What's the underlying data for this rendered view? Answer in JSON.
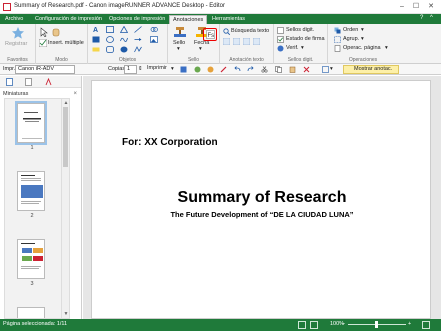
{
  "window": {
    "title": "Summary of Research.pdf - Canon imageRUNNER ADVANCE Desktop - Editor",
    "controls": [
      "–",
      "☐",
      "✕"
    ]
  },
  "menu": {
    "tabs": [
      "Archivo",
      "Configuración de impresión",
      "Opciones de impresión",
      "Anotaciones",
      "Herramientas"
    ],
    "active": "Anotaciones",
    "right_controls": [
      "?",
      "^"
    ]
  },
  "ribbon": {
    "favorites": {
      "register": "Registrar",
      "label": "Favoritos"
    },
    "mode": {
      "insert_multiple": "Insert. múltiple",
      "label": "Modo"
    },
    "objects": {
      "label": "Objetos"
    },
    "stamp": {
      "seal": "Sello",
      "date": "Fecha",
      "label": "Sello"
    },
    "annotation_text": {
      "search": "Búsqueda texto",
      "label": "Anotación texto"
    },
    "digital_seals": {
      "seals": "Sellos digit.",
      "signature_status": "Estado de firma",
      "verify": "Verif.",
      "label": "Sellos digit."
    },
    "operations": {
      "order": "Orden",
      "group": "Agrup.",
      "page_ops": "Operac. página",
      "label": "Operaciones"
    }
  },
  "toolbar": {
    "printer_label": "Impr.",
    "printer_value": "Canon iR-ADV",
    "copies_label": "Copias",
    "copies_value": "1",
    "print_label": "Imprimir",
    "show_annotations": "Mostrar anotac."
  },
  "sidebar": {
    "heading": "Miniaturas",
    "close": "×",
    "pages": [
      "1",
      "2",
      "3"
    ]
  },
  "document": {
    "for_line": "For: XX Corporation",
    "title": "Summary of Research",
    "subtitle": "The Future Development of “DE LA CIUDAD LUNA”"
  },
  "status": {
    "selected": "Página seleccionada: 1/11",
    "zoom": "100%",
    "zoom_minus": "−",
    "zoom_plus": "+"
  },
  "colors": {
    "accent": "#1f7a3a",
    "highlight": "#ee0000",
    "annotation_button": "#fdf0a8"
  }
}
